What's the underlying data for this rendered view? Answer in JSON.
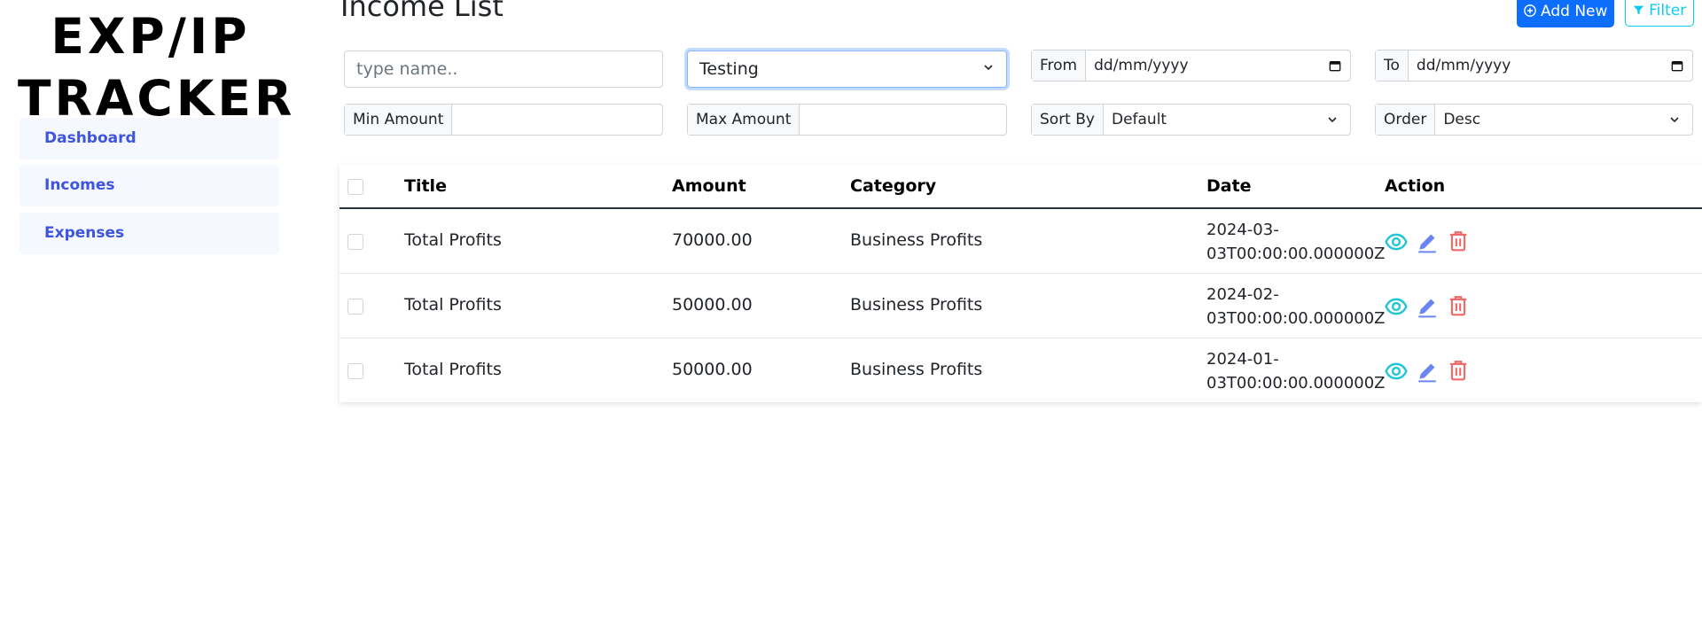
{
  "sidebar": {
    "brand_line1": "EXP/IP",
    "brand_line2": "TRACKER",
    "items": [
      {
        "label": "Dashboard"
      },
      {
        "label": "Incomes"
      },
      {
        "label": "Expenses"
      }
    ]
  },
  "header": {
    "title": "Income List",
    "add_label": "Add New",
    "filter_label": "Filter"
  },
  "filters": {
    "name_placeholder": "type name..",
    "category_value": "Testing",
    "from_label": "From",
    "from_value": "dd/mm/yyyy",
    "to_label": "To",
    "to_value": "dd/mm/yyyy",
    "min_label": "Min Amount",
    "max_label": "Max Amount",
    "sort_label": "Sort By",
    "sort_value": "Default",
    "order_label": "Order",
    "order_value": "Desc"
  },
  "table": {
    "headers": {
      "title": "Title",
      "amount": "Amount",
      "category": "Category",
      "date": "Date",
      "action": "Action"
    },
    "rows": [
      {
        "title": "Total Profits",
        "amount": "70000.00",
        "category": "Business Profits",
        "date_line1": "2024-03-",
        "date_line2": "03T00:00:00.000000Z"
      },
      {
        "title": "Total Profits",
        "amount": "50000.00",
        "category": "Business Profits",
        "date_line1": "2024-02-",
        "date_line2": "03T00:00:00.000000Z"
      },
      {
        "title": "Total Profits",
        "amount": "50000.00",
        "category": "Business Profits",
        "date_line1": "2024-01-",
        "date_line2": "03T00:00:00.000000Z"
      }
    ]
  },
  "colors": {
    "accent": "#3d55df",
    "primary_button": "#0d6efd",
    "filter_button": "#0dcaf0",
    "view_icon": "#20c5d6",
    "edit_icon": "#6b86f0",
    "delete_icon": "#f06a6a"
  },
  "icons": {
    "add": "plus-circle-icon",
    "filter": "funnel-icon",
    "view": "eye-icon",
    "edit": "pencil-icon",
    "delete": "trash-icon"
  }
}
